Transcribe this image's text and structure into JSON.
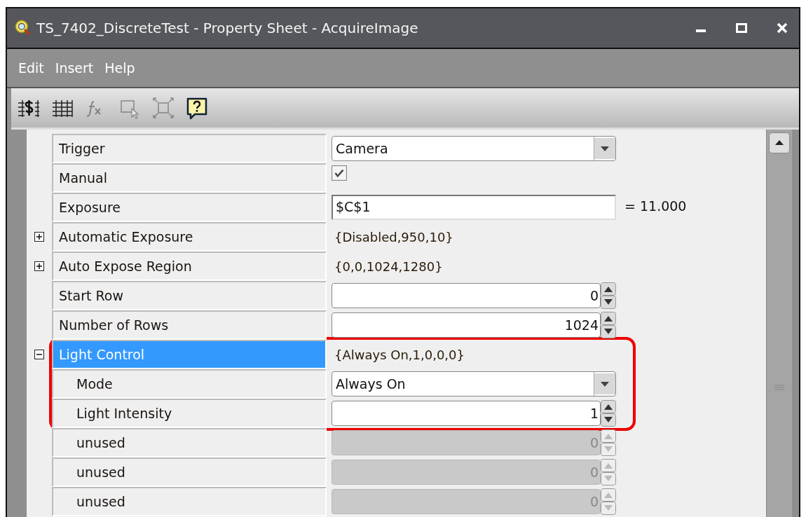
{
  "window": {
    "title": "TS_7402_DiscreteTest - Property Sheet - AcquireImage"
  },
  "menu": [
    "Edit",
    "Insert",
    "Help"
  ],
  "toolbar": [
    {
      "kind": "cellref",
      "disabled": false
    },
    {
      "kind": "grid",
      "disabled": false
    },
    {
      "kind": "function",
      "disabled": true
    },
    {
      "kind": "select",
      "disabled": true
    },
    {
      "kind": "fit",
      "disabled": true
    },
    {
      "kind": "help",
      "disabled": false
    }
  ],
  "properties": [
    {
      "name": "Trigger",
      "kind": "dropdown",
      "value": "Camera",
      "selected": false
    },
    {
      "name": "Manual",
      "kind": "checkbox",
      "checked": true,
      "selected": false
    },
    {
      "name": "Exposure",
      "kind": "text",
      "value": "$C$1",
      "result": "= 11.000",
      "selected": false
    },
    {
      "name": "Automatic Exposure",
      "kind": "summary",
      "value": "{Disabled,950,10}",
      "expanded": false,
      "selected": false
    },
    {
      "name": "Auto Expose Region",
      "kind": "summary",
      "value": "{0,0,1024,1280}",
      "expanded": false,
      "selected": false
    },
    {
      "name": "Start Row",
      "kind": "spin",
      "value": "0",
      "disabled": false,
      "selected": false
    },
    {
      "name": "Number of Rows",
      "kind": "spin",
      "value": "1024",
      "disabled": false,
      "selected": false
    },
    {
      "name": "Light Control",
      "kind": "summary",
      "value": "{Always On,1,0,0,0}",
      "expanded": true,
      "selected": true,
      "highlighted": true,
      "children": [
        {
          "name": "Mode",
          "kind": "dropdown",
          "value": "Always On",
          "selected": false,
          "highlighted": true
        },
        {
          "name": "Light Intensity",
          "kind": "spin",
          "value": "1",
          "disabled": false,
          "selected": false,
          "highlighted": true
        },
        {
          "name": "unused",
          "kind": "spin",
          "value": "0",
          "disabled": true,
          "selected": false,
          "highlighted": false
        },
        {
          "name": "unused",
          "kind": "spin",
          "value": "0",
          "disabled": true,
          "selected": false,
          "highlighted": false
        },
        {
          "name": "unused",
          "kind": "spin",
          "value": "0",
          "disabled": true,
          "selected": false,
          "highlighted": false
        }
      ]
    }
  ]
}
